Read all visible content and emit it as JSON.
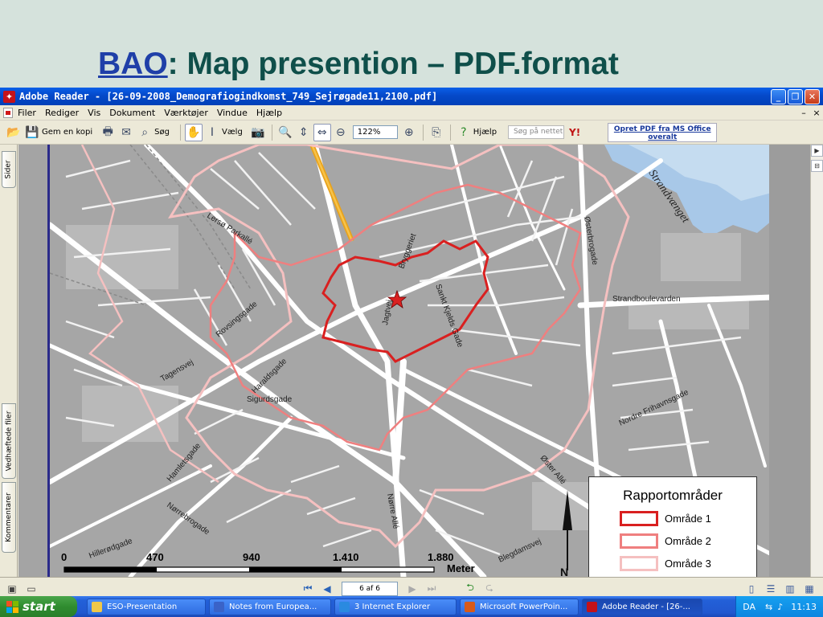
{
  "slide": {
    "title_link": "BAO",
    "title_rest": ": Map presention – PDF.format"
  },
  "window": {
    "title": "Adobe Reader - [26-09-2008_Demografiogindkomst_749_Sejrøgade11,2100.pdf]",
    "minimize": "_",
    "restore": "❐",
    "close": "✕"
  },
  "menu": {
    "items": [
      "Filer",
      "Rediger",
      "Vis",
      "Dokument",
      "Værktøjer",
      "Vindue",
      "Hjælp"
    ],
    "mini_min": "–",
    "mini_close": "×"
  },
  "toolbar": {
    "save_copy": "Gem en kopi",
    "search": "Søg",
    "select": "Vælg",
    "zoom": "122%",
    "help": "Hjælp",
    "web_search_placeholder": "Søg på nettet",
    "promo_line1": "Opret PDF fra MS Office",
    "promo_line2": "overalt"
  },
  "side_tabs": [
    "Sider",
    "Vedhæftede filer",
    "Kommentarer"
  ],
  "map": {
    "streets": [
      "Strandvænget",
      "Lersø Parkallé",
      "Bryggeriet",
      "Jagtvej",
      "Østerbrogade",
      "Strandboulevarden",
      "Rovsingsgade",
      "Haraldsgade",
      "Sigurdsgade",
      "Tagensvej",
      "Nørre Allé",
      "Hamletsgade",
      "Nordre Frihavnsgade",
      "Vibenshus",
      "Hillerødgade",
      "Nørrebrogade",
      "Blegdamsvej",
      "Lyngbyvej",
      "Sankt Kjelds Gade",
      "Øster Allé"
    ],
    "scale_labels": [
      "0",
      "470",
      "940",
      "1.410",
      "1.880"
    ],
    "scale_unit": "Meter",
    "north": "N"
  },
  "legend": {
    "title": "Rapportområder",
    "items": [
      {
        "label": "Område 1",
        "color": "#d92020"
      },
      {
        "label": "Område 2",
        "color": "#ef7f7f"
      },
      {
        "label": "Område 3",
        "color": "#f5c0c0"
      }
    ]
  },
  "statusbar": {
    "page_indicator": "6 af 6"
  },
  "taskbar": {
    "start": "start",
    "tasks": [
      {
        "label": "ESO-Presentation",
        "icon_color": "#f0c84a"
      },
      {
        "label": "Notes from Europea...",
        "icon_color": "#3a63c8"
      },
      {
        "label": "3 Internet Explorer",
        "icon_color": "#2a8ae0"
      },
      {
        "label": "Microsoft PowerPoin...",
        "icon_color": "#d85a1a"
      },
      {
        "label": "Adobe Reader - [26-...",
        "icon_color": "#c4121a"
      }
    ],
    "lang": "DA",
    "clock": "11:13"
  }
}
